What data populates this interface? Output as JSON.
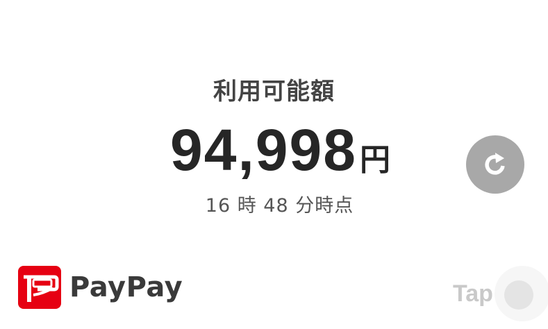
{
  "balance": {
    "label": "利用可能額",
    "amount": "94,998",
    "unit": "円",
    "timestamp": "16 時 48 分時点"
  },
  "refresh": {
    "icon": "refresh-icon",
    "color": "#a8a8a8"
  },
  "brand": {
    "name": "PayPay",
    "logo_color": "#e60012"
  },
  "tap": {
    "label": "Tap"
  }
}
